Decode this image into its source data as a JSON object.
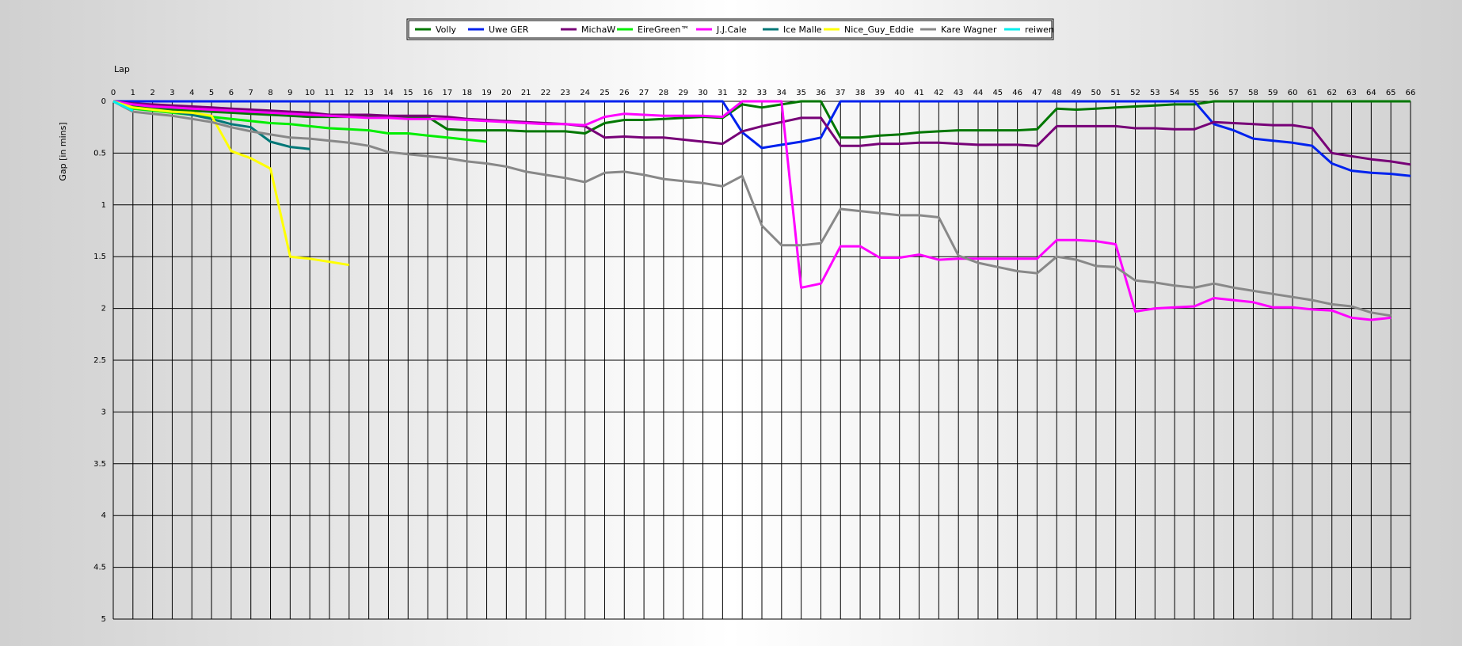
{
  "chart_data": {
    "type": "line",
    "title": "",
    "xlabel": "Lap",
    "ylabel": "Gap [in mins]",
    "xlim": [
      0,
      66
    ],
    "ylim": [
      0,
      5
    ],
    "y_inverted": true,
    "grid": true,
    "legend_position": "top-center",
    "x_ticks": [
      0,
      1,
      2,
      3,
      4,
      5,
      6,
      7,
      8,
      9,
      10,
      11,
      12,
      13,
      14,
      15,
      16,
      17,
      18,
      19,
      20,
      21,
      22,
      23,
      24,
      25,
      26,
      27,
      28,
      29,
      30,
      31,
      32,
      33,
      34,
      35,
      36,
      37,
      38,
      39,
      40,
      41,
      42,
      43,
      44,
      45,
      46,
      47,
      48,
      49,
      50,
      51,
      52,
      53,
      54,
      55,
      56,
      57,
      58,
      59,
      60,
      61,
      62,
      63,
      64,
      65,
      66
    ],
    "y_ticks": [
      0,
      0.5,
      1,
      1.5,
      2,
      2.5,
      3,
      3.5,
      4,
      4.5,
      5
    ],
    "y_tick_labels": [
      "0",
      "0.5",
      "1",
      "1.5",
      "2",
      "2.5",
      "3",
      "3.5",
      "4",
      "4.5",
      "5"
    ],
    "series": [
      {
        "name": "Volly",
        "color": "#007700",
        "x": [
          0,
          1,
          2,
          3,
          4,
          5,
          6,
          7,
          8,
          9,
          10,
          11,
          12,
          13,
          14,
          15,
          16,
          17,
          18,
          19,
          20,
          21,
          22,
          23,
          24,
          25,
          26,
          27,
          28,
          29,
          30,
          31,
          32,
          33,
          34,
          35,
          36,
          37,
          38,
          39,
          40,
          41,
          42,
          43,
          44,
          45,
          46,
          47,
          48,
          49,
          50,
          51,
          52,
          53,
          54,
          55,
          56,
          57,
          58,
          59,
          60,
          61,
          62,
          63,
          64,
          65,
          66
        ],
        "y": [
          0,
          0.05,
          0.07,
          0.08,
          0.09,
          0.1,
          0.11,
          0.12,
          0.13,
          0.14,
          0.15,
          0.15,
          0.15,
          0.15,
          0.15,
          0.15,
          0.15,
          0.27,
          0.28,
          0.28,
          0.28,
          0.29,
          0.29,
          0.29,
          0.31,
          0.21,
          0.18,
          0.18,
          0.17,
          0.16,
          0.15,
          0.16,
          0.03,
          0.06,
          0.03,
          0,
          0,
          0.35,
          0.35,
          0.33,
          0.32,
          0.3,
          0.29,
          0.28,
          0.28,
          0.28,
          0.28,
          0.27,
          0.07,
          0.08,
          0.07,
          0.06,
          0.05,
          0.04,
          0.03,
          0.03,
          0,
          0,
          0,
          0,
          0,
          0,
          0,
          0,
          0,
          0,
          0
        ]
      },
      {
        "name": "Uwe GER",
        "color": "#0022ee",
        "x": [
          0,
          1,
          2,
          3,
          4,
          5,
          6,
          7,
          8,
          9,
          10,
          11,
          12,
          13,
          14,
          15,
          16,
          17,
          18,
          19,
          20,
          21,
          22,
          23,
          24,
          25,
          26,
          27,
          28,
          29,
          30,
          31,
          32,
          33,
          34,
          35,
          36,
          37,
          38,
          39,
          40,
          41,
          42,
          43,
          44,
          45,
          46,
          47,
          48,
          49,
          50,
          51,
          52,
          53,
          54,
          55,
          56,
          57,
          58,
          59,
          60,
          61,
          62,
          63,
          64,
          65,
          66
        ],
        "y": [
          0,
          0,
          0,
          0,
          0,
          0,
          0,
          0,
          0,
          0,
          0,
          0,
          0,
          0,
          0,
          0,
          0,
          0,
          0,
          0,
          0,
          0,
          0,
          0,
          0,
          0,
          0,
          0,
          0,
          0,
          0,
          0,
          0.3,
          0.45,
          0.42,
          0.39,
          0.35,
          0,
          0,
          0,
          0,
          0,
          0,
          0,
          0,
          0,
          0,
          0,
          0,
          0,
          0,
          0,
          0,
          0,
          0,
          0,
          0.22,
          0.28,
          0.36,
          0.38,
          0.4,
          0.43,
          0.6,
          0.67,
          0.69,
          0.7,
          0.72
        ]
      },
      {
        "name": "MichaW",
        "color": "#770077",
        "x": [
          0,
          1,
          2,
          3,
          4,
          5,
          6,
          7,
          8,
          9,
          10,
          11,
          12,
          13,
          14,
          15,
          16,
          17,
          18,
          19,
          20,
          21,
          22,
          23,
          24,
          25,
          26,
          27,
          28,
          29,
          30,
          31,
          32,
          33,
          34,
          35,
          36,
          37,
          38,
          39,
          40,
          41,
          42,
          43,
          44,
          45,
          46,
          47,
          48,
          49,
          50,
          51,
          52,
          53,
          54,
          55,
          56,
          57,
          58,
          59,
          60,
          61,
          62,
          63,
          64,
          65,
          66
        ],
        "y": [
          0,
          0.02,
          0.03,
          0.04,
          0.05,
          0.06,
          0.07,
          0.08,
          0.09,
          0.1,
          0.11,
          0.13,
          0.13,
          0.13,
          0.14,
          0.14,
          0.14,
          0.15,
          0.17,
          0.18,
          0.19,
          0.2,
          0.21,
          0.22,
          0.24,
          0.35,
          0.34,
          0.35,
          0.35,
          0.37,
          0.39,
          0.41,
          0.29,
          0.24,
          0.2,
          0.16,
          0.16,
          0.43,
          0.43,
          0.41,
          0.41,
          0.4,
          0.4,
          0.41,
          0.42,
          0.42,
          0.42,
          0.43,
          0.24,
          0.24,
          0.24,
          0.24,
          0.26,
          0.26,
          0.27,
          0.27,
          0.2,
          0.21,
          0.22,
          0.23,
          0.23,
          0.26,
          0.5,
          0.53,
          0.56,
          0.58,
          0.61
        ]
      },
      {
        "name": "EireGreen™",
        "color": "#00ee00",
        "x": [
          0,
          1,
          2,
          3,
          4,
          5,
          6,
          7,
          8,
          9,
          10,
          11,
          12,
          13,
          14,
          15,
          16,
          17,
          18,
          19
        ],
        "y": [
          0,
          0.07,
          0.09,
          0.11,
          0.13,
          0.15,
          0.17,
          0.19,
          0.21,
          0.22,
          0.24,
          0.26,
          0.27,
          0.28,
          0.31,
          0.31,
          0.33,
          0.35,
          0.37,
          0.39
        ]
      },
      {
        "name": "J.J.Cale",
        "color": "#ff00ff",
        "x": [
          0,
          1,
          2,
          3,
          4,
          5,
          6,
          7,
          8,
          9,
          10,
          11,
          12,
          13,
          14,
          15,
          16,
          17,
          18,
          19,
          20,
          21,
          22,
          23,
          24,
          25,
          26,
          27,
          28,
          29,
          30,
          31,
          32,
          33,
          34,
          35,
          36,
          37,
          38,
          39,
          40,
          41,
          42,
          43,
          44,
          45,
          46,
          47,
          48,
          49,
          50,
          51,
          52,
          53,
          54,
          55,
          56,
          57,
          58,
          59,
          60,
          61,
          62,
          63,
          64,
          65
        ],
        "y": [
          0,
          0.03,
          0.05,
          0.06,
          0.07,
          0.08,
          0.09,
          0.1,
          0.11,
          0.12,
          0.13,
          0.14,
          0.15,
          0.16,
          0.16,
          0.17,
          0.17,
          0.17,
          0.18,
          0.19,
          0.2,
          0.21,
          0.22,
          0.22,
          0.23,
          0.15,
          0.12,
          0.13,
          0.14,
          0.14,
          0.14,
          0.15,
          0,
          0,
          0,
          1.8,
          1.76,
          1.4,
          1.4,
          1.51,
          1.51,
          1.48,
          1.53,
          1.52,
          1.52,
          1.52,
          1.52,
          1.52,
          1.34,
          1.34,
          1.35,
          1.38,
          2.03,
          2.0,
          1.99,
          1.98,
          1.9,
          1.92,
          1.94,
          1.99,
          1.99,
          2.01,
          2.02,
          2.09,
          2.11,
          2.09
        ]
      },
      {
        "name": "Ice Malle",
        "color": "#007777",
        "x": [
          0,
          1,
          2,
          3,
          4,
          5,
          6,
          7,
          8,
          9,
          10
        ],
        "y": [
          0,
          0.06,
          0.08,
          0.1,
          0.13,
          0.17,
          0.22,
          0.25,
          0.39,
          0.44,
          0.46
        ]
      },
      {
        "name": "Nice_Guy_Eddie",
        "color": "#ffff00",
        "x": [
          0,
          1,
          2,
          3,
          4,
          5,
          6,
          7,
          8,
          9,
          10,
          11,
          12
        ],
        "y": [
          0,
          0.06,
          0.08,
          0.1,
          0.11,
          0.14,
          0.48,
          0.55,
          0.65,
          1.5,
          1.52,
          1.55,
          1.58
        ]
      },
      {
        "name": "Kare Wagner",
        "color": "#888888",
        "x": [
          0,
          1,
          2,
          3,
          4,
          5,
          6,
          7,
          8,
          9,
          10,
          11,
          12,
          13,
          14,
          15,
          16,
          17,
          18,
          19,
          20,
          21,
          22,
          23,
          24,
          25,
          26,
          27,
          28,
          29,
          30,
          31,
          32,
          33,
          34,
          35,
          36,
          37,
          38,
          39,
          40,
          41,
          42,
          43,
          44,
          45,
          46,
          47,
          48,
          49,
          50,
          51,
          52,
          53,
          54,
          55,
          56,
          57,
          58,
          59,
          60,
          61,
          62,
          63,
          64,
          65
        ],
        "y": [
          0,
          0.1,
          0.12,
          0.14,
          0.17,
          0.2,
          0.25,
          0.29,
          0.32,
          0.35,
          0.36,
          0.38,
          0.4,
          0.43,
          0.49,
          0.51,
          0.53,
          0.55,
          0.58,
          0.6,
          0.63,
          0.68,
          0.71,
          0.74,
          0.78,
          0.69,
          0.68,
          0.71,
          0.75,
          0.77,
          0.79,
          0.82,
          0.72,
          1.2,
          1.39,
          1.39,
          1.37,
          1.04,
          1.06,
          1.08,
          1.1,
          1.1,
          1.12,
          1.49,
          1.56,
          1.6,
          1.64,
          1.66,
          1.5,
          1.53,
          1.59,
          1.6,
          1.73,
          1.75,
          1.78,
          1.8,
          1.76,
          1.8,
          1.83,
          1.86,
          1.89,
          1.92,
          1.96,
          1.98,
          2.04,
          2.07
        ]
      },
      {
        "name": "reiwen",
        "color": "#00eeee",
        "x": [
          0,
          1
        ],
        "y": [
          0,
          0.09
        ]
      }
    ]
  }
}
